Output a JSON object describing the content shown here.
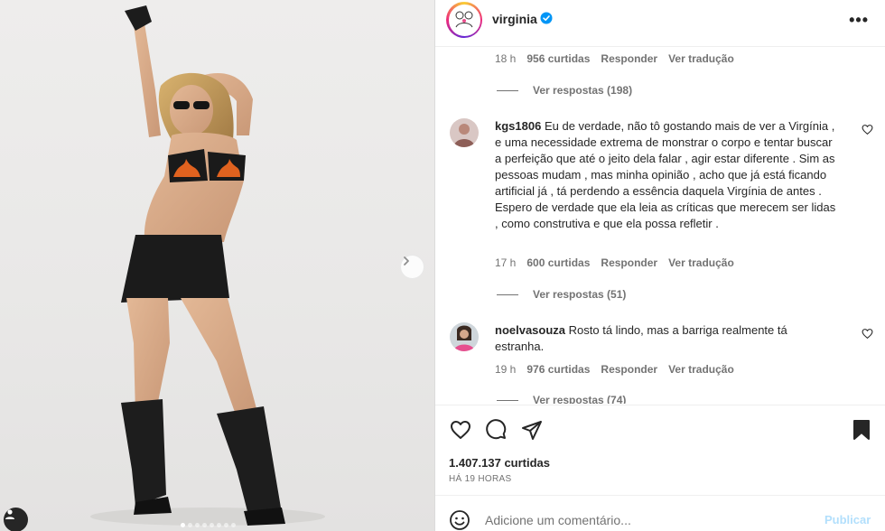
{
  "post": {
    "username": "virginia",
    "more_icon": "more-horizontal-icon",
    "verified_icon": "verified-badge-icon",
    "carousel_dots": 8,
    "carousel_active_index": 0
  },
  "top_meta": {
    "time": "18 h",
    "likes": "956 curtidas",
    "reply": "Responder",
    "translate": "Ver tradução"
  },
  "top_replies": {
    "label": "Ver respostas (198)"
  },
  "comments": [
    {
      "username": "kgs1806",
      "text": "Eu de verdade, não tô gostando mais de ver a Virgínia , e uma necessidade extrema de monstrar o corpo e tentar buscar a perfeição que até o jeito dela falar , agir estar diferente . Sim as pessoas mudam , mas minha opinião , acho que já está ficando artificial já , tá perdendo a essência daquela Virgínia de antes . Espero de verdade que ela leia as críticas que merecem ser lidas , como construtiva e que ela possa refletir .",
      "time": "17 h",
      "likes": "600 curtidas",
      "reply": "Responder",
      "translate": "Ver tradução",
      "replies": "Ver respostas (51)"
    },
    {
      "username": "noelvasouza",
      "text": "Rosto tá lindo, mas a barriga realmente tá estranha.",
      "time": "19 h",
      "likes": "976 curtidas",
      "reply": "Responder",
      "translate": "Ver tradução",
      "replies": "Ver respostas (74)"
    }
  ],
  "actions": {
    "like_icon": "heart-icon",
    "comment_icon": "comment-icon",
    "share_icon": "send-icon",
    "save_icon": "bookmark-filled-icon",
    "likes_count": "1.407.137 curtidas",
    "posted_ago": "HÁ 19 HORAS"
  },
  "add_comment": {
    "placeholder": "Adicione um comentário...",
    "publish": "Publicar"
  }
}
